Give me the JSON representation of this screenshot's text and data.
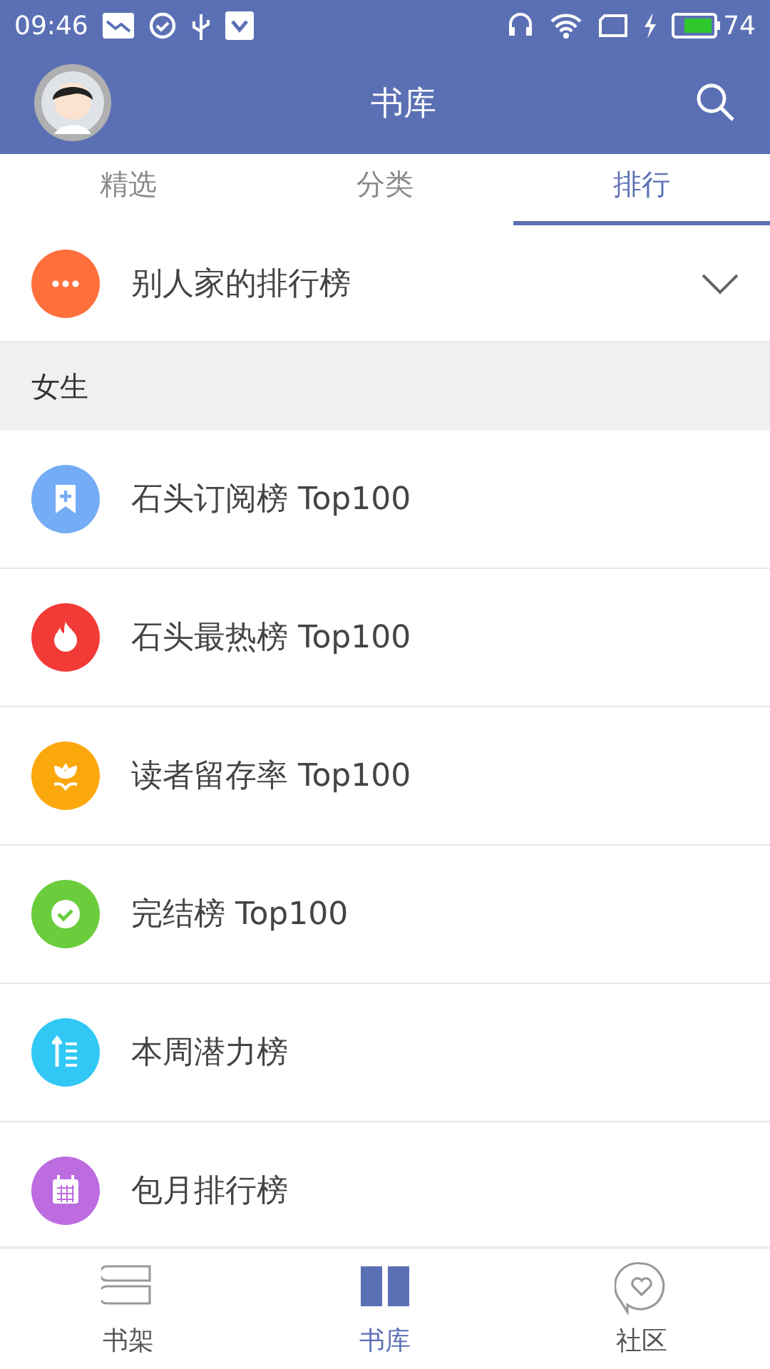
{
  "status_bar": {
    "time": "09:46",
    "battery": "74"
  },
  "header": {
    "title": "书库"
  },
  "tabs": [
    {
      "label": "精选",
      "selected": false
    },
    {
      "label": "分类",
      "selected": false
    },
    {
      "label": "排行",
      "selected": true
    }
  ],
  "others_ranking": {
    "label": "别人家的排行榜",
    "expanded": false
  },
  "section": {
    "title": "女生"
  },
  "rankings": [
    {
      "label": "石头订阅榜 Top100",
      "kind": "bookmark",
      "color": "#74acf5"
    },
    {
      "label": "石头最热榜 Top100",
      "kind": "flame",
      "color": "#f23a36"
    },
    {
      "label": "读者留存率 Top100",
      "kind": "flower",
      "color": "#fba80d"
    },
    {
      "label": "完结榜 Top100",
      "kind": "check",
      "color": "#6bcc3c"
    },
    {
      "label": "本周潜力榜",
      "kind": "sort",
      "color": "#31c8f5"
    },
    {
      "label": "包月排行榜",
      "kind": "calendar",
      "color": "#bd6ce0"
    }
  ],
  "bottom_nav": [
    {
      "label": "书架",
      "kind": "shelf",
      "selected": false
    },
    {
      "label": "书库",
      "kind": "book",
      "selected": true
    },
    {
      "label": "社区",
      "kind": "chat",
      "selected": false
    }
  ]
}
